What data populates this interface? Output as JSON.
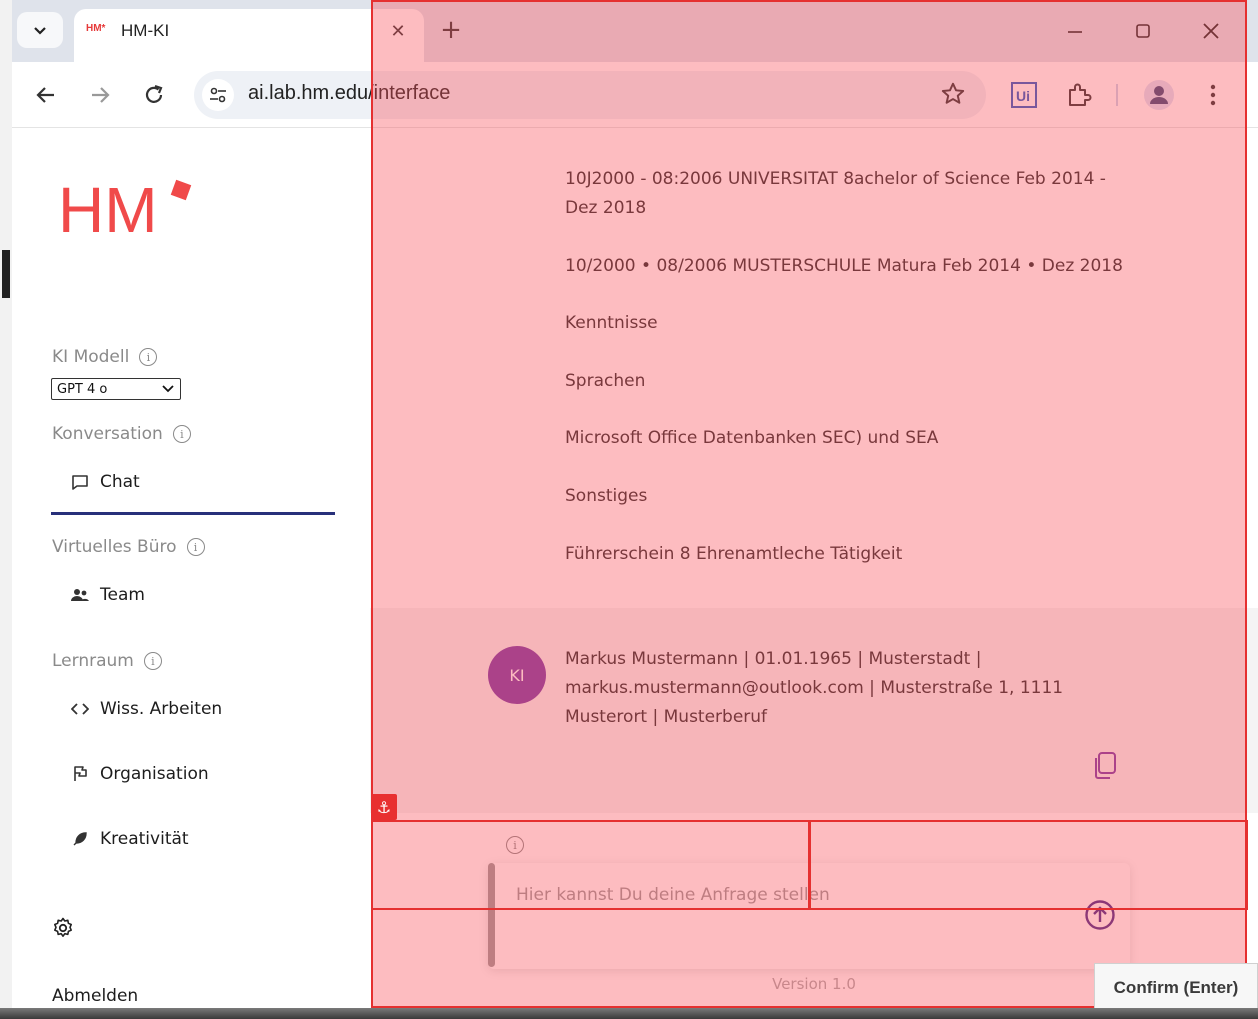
{
  "browser": {
    "tab_title": "HM-KI",
    "tab_favicon": "HM*",
    "url": "ai.lab.hm.edu/interface",
    "extensions": [
      "uipath-icon",
      "puzzle-icon"
    ]
  },
  "sidebar": {
    "logo_text": "HM",
    "ki_modell_label": "KI Modell",
    "model_selected": "GPT 4 o",
    "konversation_label": "Konversation",
    "chat_label": "Chat",
    "virtuelles_buero_label": "Virtuelles Büro",
    "team_label": "Team",
    "lernraum_label": "Lernraum",
    "wiss_label": "Wiss. Arbeiten",
    "organisation_label": "Organisation",
    "kreativitaet_label": "Kreativität",
    "logout_label": "Abmelden"
  },
  "chat": {
    "ai_lines": [
      "10J2000 - 08:2006 UNIVERSITAT 8achelor of Science Feb 2014 - Dez 2018",
      "10/2000 • 08/2006 MUSTERSCHULE Matura Feb 2014 • Dez 2018",
      "Kenntnisse",
      "Sprachen",
      "Microsoft Office Datenbanken SEC) und SEA",
      "Sonstiges",
      "Führerschein 8 Ehrenamtleche Tätigkeit"
    ],
    "user_avatar": "KI",
    "user_message": "Markus Mustermann | 01.01.1965 | Musterstadt | markus.mustermann@outlook.com | Musterstraße 1, 1111 Musterort | Musterberuf",
    "input_placeholder": "Hier kannst Du deine Anfrage stellen",
    "version": "Version 1.0"
  },
  "overlay": {
    "anchor_symbol": "⚓",
    "confirm_label": "Confirm (Enter)",
    "color": "#e53030"
  }
}
